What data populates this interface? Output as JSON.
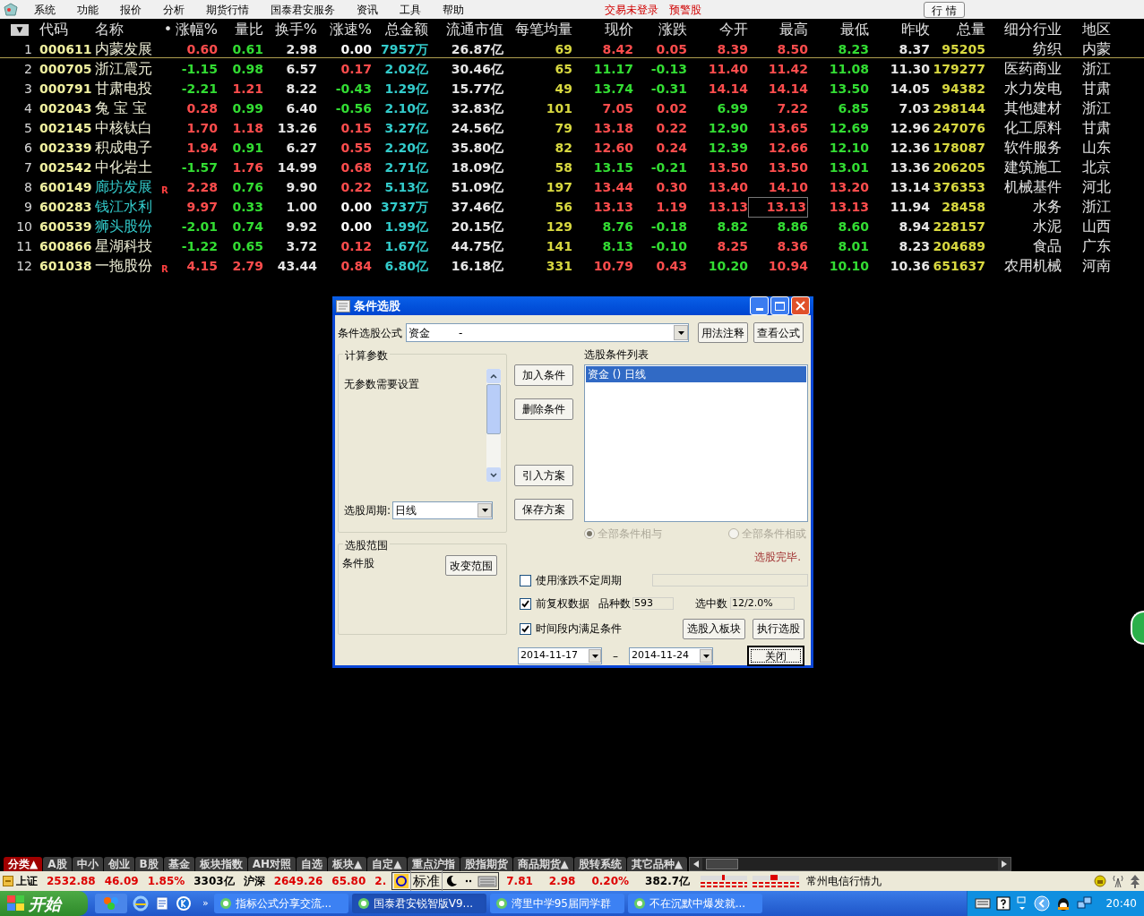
{
  "menu_bar": {
    "items": [
      "系统",
      "功能",
      "报价",
      "分析",
      "期货行情",
      "国泰君安服务",
      "资讯",
      "工具",
      "帮助"
    ],
    "alerts": [
      "交易未登录",
      "预警股"
    ],
    "quote_button": "行 情"
  },
  "table": {
    "columns": [
      "▼",
      "代码",
      "名称",
      "•",
      "涨幅%",
      "量比",
      "换手%",
      "涨速%",
      "总金额",
      "流通市值",
      "每笔均量",
      "现价",
      "涨跌",
      "今开",
      "最高",
      "最低",
      "昨收",
      "总量",
      "细分行业",
      "地区"
    ],
    "rows": [
      {
        "selected": true,
        "cells": [
          {
            "text": "1",
            "color": "#d8d8d8"
          },
          {
            "text": "000611",
            "color": "#f0f0a0"
          },
          {
            "text": "内蒙发展",
            "color": "#f0f0d8"
          },
          {
            "text": ""
          },
          {
            "text": "0.60",
            "color": "#ff4d4d"
          },
          {
            "text": "0.61",
            "color": "#33dd33"
          },
          {
            "text": "2.98",
            "color": "#e6e6e6"
          },
          {
            "text": "0.00",
            "color": "#ffffff"
          },
          {
            "text": "7957万",
            "color": "#33cccc"
          },
          {
            "text": "26.87亿",
            "color": "#e6e6e6"
          },
          {
            "text": "69",
            "color": "#d8d840"
          },
          {
            "text": "8.42",
            "color": "#ff4d4d"
          },
          {
            "text": "0.05",
            "color": "#ff4d4d"
          },
          {
            "text": "8.39",
            "color": "#ff4d4d"
          },
          {
            "text": "8.50",
            "color": "#ff4d4d"
          },
          {
            "text": "8.23",
            "color": "#33dd33"
          },
          {
            "text": "8.37",
            "color": "#e6e6e6"
          },
          {
            "text": "95205",
            "color": "#d8d840"
          },
          {
            "text": "纺织",
            "color": "#e6e6e6"
          },
          {
            "text": "内蒙",
            "color": "#e6e6e6"
          }
        ]
      },
      {
        "selected": false,
        "cells": [
          {
            "text": "2",
            "color": "#d8d8d8"
          },
          {
            "text": "000705",
            "color": "#f0f0a0"
          },
          {
            "text": "浙江震元",
            "color": "#f0f0d8"
          },
          {
            "text": ""
          },
          {
            "text": "-1.15",
            "color": "#33dd33"
          },
          {
            "text": "0.98",
            "color": "#33dd33"
          },
          {
            "text": "6.57",
            "color": "#e6e6e6"
          },
          {
            "text": "0.17",
            "color": "#ff4d4d"
          },
          {
            "text": "2.02亿",
            "color": "#33cccc"
          },
          {
            "text": "30.46亿",
            "color": "#e6e6e6"
          },
          {
            "text": "65",
            "color": "#d8d840"
          },
          {
            "text": "11.17",
            "color": "#33dd33"
          },
          {
            "text": "-0.13",
            "color": "#33dd33"
          },
          {
            "text": "11.40",
            "color": "#ff4d4d"
          },
          {
            "text": "11.42",
            "color": "#ff4d4d"
          },
          {
            "text": "11.08",
            "color": "#33dd33"
          },
          {
            "text": "11.30",
            "color": "#e6e6e6"
          },
          {
            "text": "179277",
            "color": "#d8d840"
          },
          {
            "text": "医药商业",
            "color": "#e6e6e6"
          },
          {
            "text": "浙江",
            "color": "#e6e6e6"
          }
        ]
      },
      {
        "selected": false,
        "cells": [
          {
            "text": "3",
            "color": "#d8d8d8"
          },
          {
            "text": "000791",
            "color": "#f0f0a0"
          },
          {
            "text": "甘肃电投",
            "color": "#f0f0d8"
          },
          {
            "text": ""
          },
          {
            "text": "-2.21",
            "color": "#33dd33"
          },
          {
            "text": "1.21",
            "color": "#ff4d4d"
          },
          {
            "text": "8.22",
            "color": "#e6e6e6"
          },
          {
            "text": "-0.43",
            "color": "#33dd33"
          },
          {
            "text": "1.29亿",
            "color": "#33cccc"
          },
          {
            "text": "15.77亿",
            "color": "#e6e6e6"
          },
          {
            "text": "49",
            "color": "#d8d840"
          },
          {
            "text": "13.74",
            "color": "#33dd33"
          },
          {
            "text": "-0.31",
            "color": "#33dd33"
          },
          {
            "text": "14.14",
            "color": "#ff4d4d"
          },
          {
            "text": "14.14",
            "color": "#ff4d4d"
          },
          {
            "text": "13.50",
            "color": "#33dd33"
          },
          {
            "text": "14.05",
            "color": "#e6e6e6"
          },
          {
            "text": "94382",
            "color": "#d8d840"
          },
          {
            "text": "水力发电",
            "color": "#e6e6e6"
          },
          {
            "text": "甘肃",
            "color": "#e6e6e6"
          }
        ]
      },
      {
        "selected": false,
        "cells": [
          {
            "text": "4",
            "color": "#d8d8d8"
          },
          {
            "text": "002043",
            "color": "#f0f0a0"
          },
          {
            "text": "兔 宝 宝",
            "color": "#f0f0d8"
          },
          {
            "text": ""
          },
          {
            "text": "0.28",
            "color": "#ff4d4d"
          },
          {
            "text": "0.99",
            "color": "#33dd33"
          },
          {
            "text": "6.40",
            "color": "#e6e6e6"
          },
          {
            "text": "-0.56",
            "color": "#33dd33"
          },
          {
            "text": "2.10亿",
            "color": "#33cccc"
          },
          {
            "text": "32.83亿",
            "color": "#e6e6e6"
          },
          {
            "text": "101",
            "color": "#d8d840"
          },
          {
            "text": "7.05",
            "color": "#ff4d4d"
          },
          {
            "text": "0.02",
            "color": "#ff4d4d"
          },
          {
            "text": "6.99",
            "color": "#33dd33"
          },
          {
            "text": "7.22",
            "color": "#ff4d4d"
          },
          {
            "text": "6.85",
            "color": "#33dd33"
          },
          {
            "text": "7.03",
            "color": "#e6e6e6"
          },
          {
            "text": "298144",
            "color": "#d8d840"
          },
          {
            "text": "其他建材",
            "color": "#e6e6e6"
          },
          {
            "text": "浙江",
            "color": "#e6e6e6"
          }
        ]
      },
      {
        "selected": false,
        "cells": [
          {
            "text": "5",
            "color": "#d8d8d8"
          },
          {
            "text": "002145",
            "color": "#f0f0a0"
          },
          {
            "text": "中核钛白",
            "color": "#f0f0d8"
          },
          {
            "text": ""
          },
          {
            "text": "1.70",
            "color": "#ff4d4d"
          },
          {
            "text": "1.18",
            "color": "#ff4d4d"
          },
          {
            "text": "13.26",
            "color": "#e6e6e6"
          },
          {
            "text": "0.15",
            "color": "#ff4d4d"
          },
          {
            "text": "3.27亿",
            "color": "#33cccc"
          },
          {
            "text": "24.56亿",
            "color": "#e6e6e6"
          },
          {
            "text": "79",
            "color": "#d8d840"
          },
          {
            "text": "13.18",
            "color": "#ff4d4d"
          },
          {
            "text": "0.22",
            "color": "#ff4d4d"
          },
          {
            "text": "12.90",
            "color": "#33dd33"
          },
          {
            "text": "13.65",
            "color": "#ff4d4d"
          },
          {
            "text": "12.69",
            "color": "#33dd33"
          },
          {
            "text": "12.96",
            "color": "#e6e6e6"
          },
          {
            "text": "247076",
            "color": "#d8d840"
          },
          {
            "text": "化工原料",
            "color": "#e6e6e6"
          },
          {
            "text": "甘肃",
            "color": "#e6e6e6"
          }
        ]
      },
      {
        "selected": false,
        "cells": [
          {
            "text": "6",
            "color": "#d8d8d8"
          },
          {
            "text": "002339",
            "color": "#f0f0a0"
          },
          {
            "text": "积成电子",
            "color": "#f0f0d8"
          },
          {
            "text": ""
          },
          {
            "text": "1.94",
            "color": "#ff4d4d"
          },
          {
            "text": "0.91",
            "color": "#33dd33"
          },
          {
            "text": "6.27",
            "color": "#e6e6e6"
          },
          {
            "text": "0.55",
            "color": "#ff4d4d"
          },
          {
            "text": "2.20亿",
            "color": "#33cccc"
          },
          {
            "text": "35.80亿",
            "color": "#e6e6e6"
          },
          {
            "text": "82",
            "color": "#d8d840"
          },
          {
            "text": "12.60",
            "color": "#ff4d4d"
          },
          {
            "text": "0.24",
            "color": "#ff4d4d"
          },
          {
            "text": "12.39",
            "color": "#33dd33"
          },
          {
            "text": "12.66",
            "color": "#ff4d4d"
          },
          {
            "text": "12.10",
            "color": "#33dd33"
          },
          {
            "text": "12.36",
            "color": "#e6e6e6"
          },
          {
            "text": "178087",
            "color": "#d8d840"
          },
          {
            "text": "软件服务",
            "color": "#e6e6e6"
          },
          {
            "text": "山东",
            "color": "#e6e6e6"
          }
        ]
      },
      {
        "selected": false,
        "cells": [
          {
            "text": "7",
            "color": "#d8d8d8"
          },
          {
            "text": "002542",
            "color": "#f0f0a0"
          },
          {
            "text": "中化岩土",
            "color": "#f0f0d8"
          },
          {
            "text": ""
          },
          {
            "text": "-1.57",
            "color": "#33dd33"
          },
          {
            "text": "1.76",
            "color": "#ff4d4d"
          },
          {
            "text": "14.99",
            "color": "#e6e6e6"
          },
          {
            "text": "0.68",
            "color": "#ff4d4d"
          },
          {
            "text": "2.71亿",
            "color": "#33cccc"
          },
          {
            "text": "18.09亿",
            "color": "#e6e6e6"
          },
          {
            "text": "58",
            "color": "#d8d840"
          },
          {
            "text": "13.15",
            "color": "#33dd33"
          },
          {
            "text": "-0.21",
            "color": "#33dd33"
          },
          {
            "text": "13.50",
            "color": "#ff4d4d"
          },
          {
            "text": "13.50",
            "color": "#ff4d4d"
          },
          {
            "text": "13.01",
            "color": "#33dd33"
          },
          {
            "text": "13.36",
            "color": "#e6e6e6"
          },
          {
            "text": "206205",
            "color": "#d8d840"
          },
          {
            "text": "建筑施工",
            "color": "#e6e6e6"
          },
          {
            "text": "北京",
            "color": "#e6e6e6"
          }
        ]
      },
      {
        "selected": false,
        "cells": [
          {
            "text": "8",
            "color": "#d8d8d8"
          },
          {
            "text": "600149",
            "color": "#f0f0a0"
          },
          {
            "text": "廊坊发展",
            "color": "#33cccc"
          },
          {
            "text": "R",
            "color": "#ff4040"
          },
          {
            "text": "2.28",
            "color": "#ff4d4d"
          },
          {
            "text": "0.76",
            "color": "#33dd33"
          },
          {
            "text": "9.90",
            "color": "#e6e6e6"
          },
          {
            "text": "0.22",
            "color": "#ff4d4d"
          },
          {
            "text": "5.13亿",
            "color": "#33cccc"
          },
          {
            "text": "51.09亿",
            "color": "#e6e6e6"
          },
          {
            "text": "197",
            "color": "#d8d840"
          },
          {
            "text": "13.44",
            "color": "#ff4d4d"
          },
          {
            "text": "0.30",
            "color": "#ff4d4d"
          },
          {
            "text": "13.40",
            "color": "#ff4d4d"
          },
          {
            "text": "14.10",
            "color": "#ff4d4d"
          },
          {
            "text": "13.20",
            "color": "#ff4d4d"
          },
          {
            "text": "13.14",
            "color": "#e6e6e6"
          },
          {
            "text": "376353",
            "color": "#d8d840"
          },
          {
            "text": "机械基件",
            "color": "#e6e6e6"
          },
          {
            "text": "河北",
            "color": "#e6e6e6"
          }
        ]
      },
      {
        "selected": false,
        "cells": [
          {
            "text": "9",
            "color": "#d8d8d8"
          },
          {
            "text": "600283",
            "color": "#f0f0a0"
          },
          {
            "text": "钱江水利",
            "color": "#33cccc"
          },
          {
            "text": ""
          },
          {
            "text": "9.97",
            "color": "#ff4d4d"
          },
          {
            "text": "0.33",
            "color": "#33dd33"
          },
          {
            "text": "1.00",
            "color": "#e6e6e6"
          },
          {
            "text": "0.00",
            "color": "#ffffff"
          },
          {
            "text": "3737万",
            "color": "#33cccc"
          },
          {
            "text": "37.46亿",
            "color": "#e6e6e6"
          },
          {
            "text": "56",
            "color": "#d8d840"
          },
          {
            "text": "13.13",
            "color": "#ff4d4d"
          },
          {
            "text": "1.19",
            "color": "#ff4d4d"
          },
          {
            "text": "13.13",
            "color": "#ff4d4d"
          },
          {
            "text": "13.13",
            "color": "#ff4d4d",
            "focused": true
          },
          {
            "text": "13.13",
            "color": "#ff4d4d"
          },
          {
            "text": "11.94",
            "color": "#e6e6e6"
          },
          {
            "text": "28458",
            "color": "#d8d840"
          },
          {
            "text": "水务",
            "color": "#e6e6e6"
          },
          {
            "text": "浙江",
            "color": "#e6e6e6"
          }
        ]
      },
      {
        "selected": false,
        "cells": [
          {
            "text": "10",
            "color": "#d8d8d8"
          },
          {
            "text": "600539",
            "color": "#f0f0a0"
          },
          {
            "text": "狮头股份",
            "color": "#33cccc"
          },
          {
            "text": ""
          },
          {
            "text": "-2.01",
            "color": "#33dd33"
          },
          {
            "text": "0.74",
            "color": "#33dd33"
          },
          {
            "text": "9.92",
            "color": "#e6e6e6"
          },
          {
            "text": "0.00",
            "color": "#ffffff"
          },
          {
            "text": "1.99亿",
            "color": "#33cccc"
          },
          {
            "text": "20.15亿",
            "color": "#e6e6e6"
          },
          {
            "text": "129",
            "color": "#d8d840"
          },
          {
            "text": "8.76",
            "color": "#33dd33"
          },
          {
            "text": "-0.18",
            "color": "#33dd33"
          },
          {
            "text": "8.82",
            "color": "#33dd33"
          },
          {
            "text": "8.86",
            "color": "#33dd33"
          },
          {
            "text": "8.60",
            "color": "#33dd33"
          },
          {
            "text": "8.94",
            "color": "#e6e6e6"
          },
          {
            "text": "228157",
            "color": "#d8d840"
          },
          {
            "text": "水泥",
            "color": "#e6e6e6"
          },
          {
            "text": "山西",
            "color": "#e6e6e6"
          }
        ]
      },
      {
        "selected": false,
        "cells": [
          {
            "text": "11",
            "color": "#d8d8d8"
          },
          {
            "text": "600866",
            "color": "#f0f0a0"
          },
          {
            "text": "星湖科技",
            "color": "#f0f0d8"
          },
          {
            "text": ""
          },
          {
            "text": "-1.22",
            "color": "#33dd33"
          },
          {
            "text": "0.65",
            "color": "#33dd33"
          },
          {
            "text": "3.72",
            "color": "#e6e6e6"
          },
          {
            "text": "0.12",
            "color": "#ff4d4d"
          },
          {
            "text": "1.67亿",
            "color": "#33cccc"
          },
          {
            "text": "44.75亿",
            "color": "#e6e6e6"
          },
          {
            "text": "141",
            "color": "#d8d840"
          },
          {
            "text": "8.13",
            "color": "#33dd33"
          },
          {
            "text": "-0.10",
            "color": "#33dd33"
          },
          {
            "text": "8.25",
            "color": "#ff4d4d"
          },
          {
            "text": "8.36",
            "color": "#ff4d4d"
          },
          {
            "text": "8.01",
            "color": "#33dd33"
          },
          {
            "text": "8.23",
            "color": "#e6e6e6"
          },
          {
            "text": "204689",
            "color": "#d8d840"
          },
          {
            "text": "食品",
            "color": "#e6e6e6"
          },
          {
            "text": "广东",
            "color": "#e6e6e6"
          }
        ]
      },
      {
        "selected": false,
        "cells": [
          {
            "text": "12",
            "color": "#d8d8d8"
          },
          {
            "text": "601038",
            "color": "#f0f0a0"
          },
          {
            "text": "一拖股份",
            "color": "#f0f0d8"
          },
          {
            "text": "R",
            "color": "#ff4040"
          },
          {
            "text": "4.15",
            "color": "#ff4d4d"
          },
          {
            "text": "2.79",
            "color": "#ff4d4d"
          },
          {
            "text": "43.44",
            "color": "#e6e6e6"
          },
          {
            "text": "0.84",
            "color": "#ff4d4d"
          },
          {
            "text": "6.80亿",
            "color": "#33cccc"
          },
          {
            "text": "16.18亿",
            "color": "#e6e6e6"
          },
          {
            "text": "331",
            "color": "#d8d840"
          },
          {
            "text": "10.79",
            "color": "#ff4d4d"
          },
          {
            "text": "0.43",
            "color": "#ff4d4d"
          },
          {
            "text": "10.20",
            "color": "#33dd33"
          },
          {
            "text": "10.94",
            "color": "#ff4d4d"
          },
          {
            "text": "10.10",
            "color": "#33dd33"
          },
          {
            "text": "10.36",
            "color": "#e6e6e6"
          },
          {
            "text": "651637",
            "color": "#d8d840"
          },
          {
            "text": "农用机械",
            "color": "#e6e6e6"
          },
          {
            "text": "河南",
            "color": "#e6e6e6"
          }
        ]
      }
    ]
  },
  "dialog": {
    "title": "条件选股",
    "formula_label": "条件选股公式",
    "formula_field": {
      "value": "资金",
      "suffix": "-"
    },
    "usage_button": "用法注释",
    "view_button": "查看公式",
    "params_group": {
      "title": "计算参数",
      "message": "无参数需要设置",
      "period_label": "选股周期:",
      "period_value": "日线"
    },
    "range_group": {
      "title": "选股范围",
      "value": "条件股",
      "button": "改变范围"
    },
    "middle_buttons": [
      "加入条件",
      "删除条件",
      "引入方案",
      "保存方案"
    ],
    "condition_list": {
      "title": "选股条件列表",
      "items": [
        {
          "label": "资金 () 日线",
          "selected": true
        }
      ]
    },
    "logic_radios": [
      {
        "label": "全部条件相与",
        "selected": true,
        "disabled": true
      },
      {
        "label": "全部条件相或",
        "selected": false,
        "disabled": true
      }
    ],
    "status": "选股完毕.",
    "options": [
      {
        "label": "使用涨跌不定周期",
        "checked": false
      },
      {
        "label": "前复权数据",
        "checked": true
      },
      {
        "label": "时间段内满足条件",
        "checked": true
      }
    ],
    "count_label": "品种数",
    "count_value": "593",
    "hit_label": "选中数",
    "hit_value": "12/2.0%",
    "to_block_button": "选股入板块",
    "run_button": "执行选股",
    "date_from": "2014-11-17",
    "date_sep": "–",
    "date_to": "2014-11-24",
    "close_button": "关闭"
  },
  "category_tabs": [
    {
      "label": "分类▲",
      "selected": true
    },
    {
      "label": "A股",
      "selected": false
    },
    {
      "label": "中小",
      "selected": false
    },
    {
      "label": "创业",
      "selected": false
    },
    {
      "label": "B股",
      "selected": false
    },
    {
      "label": "基金",
      "selected": false
    },
    {
      "label": "板块指数",
      "selected": false
    },
    {
      "label": "AH对照",
      "selected": false
    },
    {
      "label": "自选",
      "selected": false
    },
    {
      "label": "板块▲",
      "selected": false
    },
    {
      "label": "自定▲",
      "selected": false
    },
    {
      "label": "重点沪指",
      "selected": false
    },
    {
      "label": "股指期货",
      "selected": false
    },
    {
      "label": "商品期货▲",
      "selected": false
    },
    {
      "label": "股转系统",
      "selected": false
    },
    {
      "label": "其它品种▲",
      "selected": false
    }
  ],
  "status_bar": {
    "before": [
      {
        "text": "上证",
        "color": "#000000"
      },
      {
        "text": "2532.88",
        "color": "#dd0000"
      },
      {
        "text": "46.09",
        "color": "#dd0000"
      },
      {
        "text": "1.85%",
        "color": "#dd0000"
      },
      {
        "text": "3303亿",
        "color": "#000000"
      },
      {
        "text": "沪深",
        "color": "#000000"
      },
      {
        "text": "2649.26",
        "color": "#dd0000"
      },
      {
        "text": "65.80",
        "color": "#dd0000"
      },
      {
        "text": "2.",
        "color": "#dd0000"
      }
    ],
    "ime_mode": "标准",
    "after": [
      {
        "text": "7.81",
        "color": "#dd0000"
      },
      {
        "text": "2.98",
        "color": "#dd0000"
      },
      {
        "text": "0.20%",
        "color": "#dd0000"
      },
      {
        "text": "382.7亿",
        "color": "#000000"
      }
    ],
    "provider": "常州电信行情九"
  },
  "taskbar": {
    "start": "开始",
    "more": "»",
    "tasks": [
      {
        "label": "指标公式分享交流...",
        "selected": false
      },
      {
        "label": "国泰君安锐智版V9...",
        "selected": true
      },
      {
        "label": "湾里中学95届同学群",
        "selected": false
      },
      {
        "label": "不在沉默中爆发就...",
        "selected": false
      }
    ],
    "clock": "20:40"
  }
}
